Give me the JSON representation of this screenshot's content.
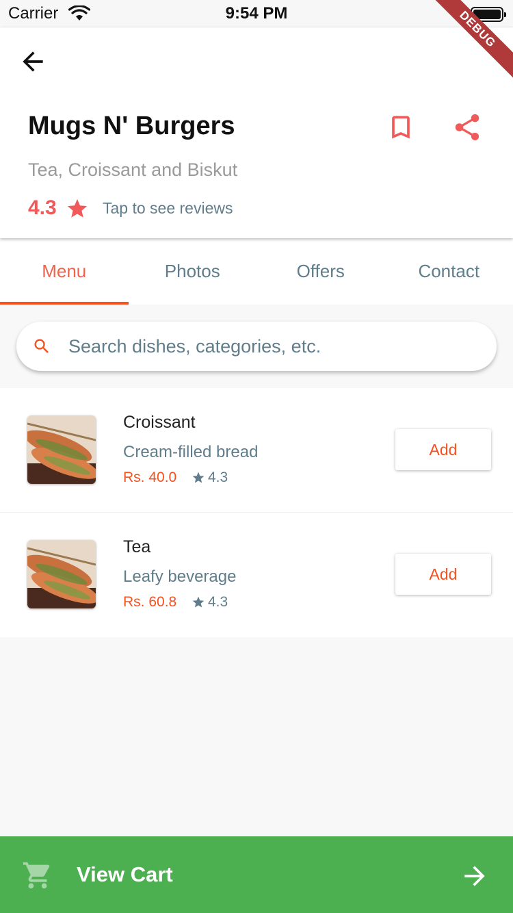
{
  "status_bar": {
    "carrier": "Carrier",
    "time": "9:54 PM"
  },
  "debug_banner": "DEBUG",
  "restaurant": {
    "name": "Mugs N' Burgers",
    "tagline": "Tea, Croissant and Biskut",
    "rating": "4.3",
    "reviews_link": "Tap to see reviews"
  },
  "tabs": [
    {
      "label": "Menu",
      "active": true
    },
    {
      "label": "Photos",
      "active": false
    },
    {
      "label": "Offers",
      "active": false
    },
    {
      "label": "Contact",
      "active": false
    }
  ],
  "search": {
    "placeholder": "Search dishes, categories, etc."
  },
  "menu_items": [
    {
      "name": "Croissant",
      "description": "Cream-filled bread",
      "price": "Rs. 40.0",
      "rating": "4.3",
      "add_label": "Add"
    },
    {
      "name": "Tea",
      "description": "Leafy beverage",
      "price": "Rs. 60.8",
      "rating": "4.3",
      "add_label": "Add"
    }
  ],
  "cart": {
    "label": "View Cart"
  },
  "colors": {
    "accent": "#f4511e",
    "heart_red": "#f05a5a",
    "muted": "#607d8b",
    "cart_green": "#4caf50"
  },
  "icons": {
    "back": "arrow-back-icon",
    "bookmark": "bookmark-icon",
    "share": "share-icon",
    "rating_star": "star-icon",
    "search": "search-icon",
    "cart": "shopping-cart-icon",
    "forward": "arrow-forward-icon"
  }
}
